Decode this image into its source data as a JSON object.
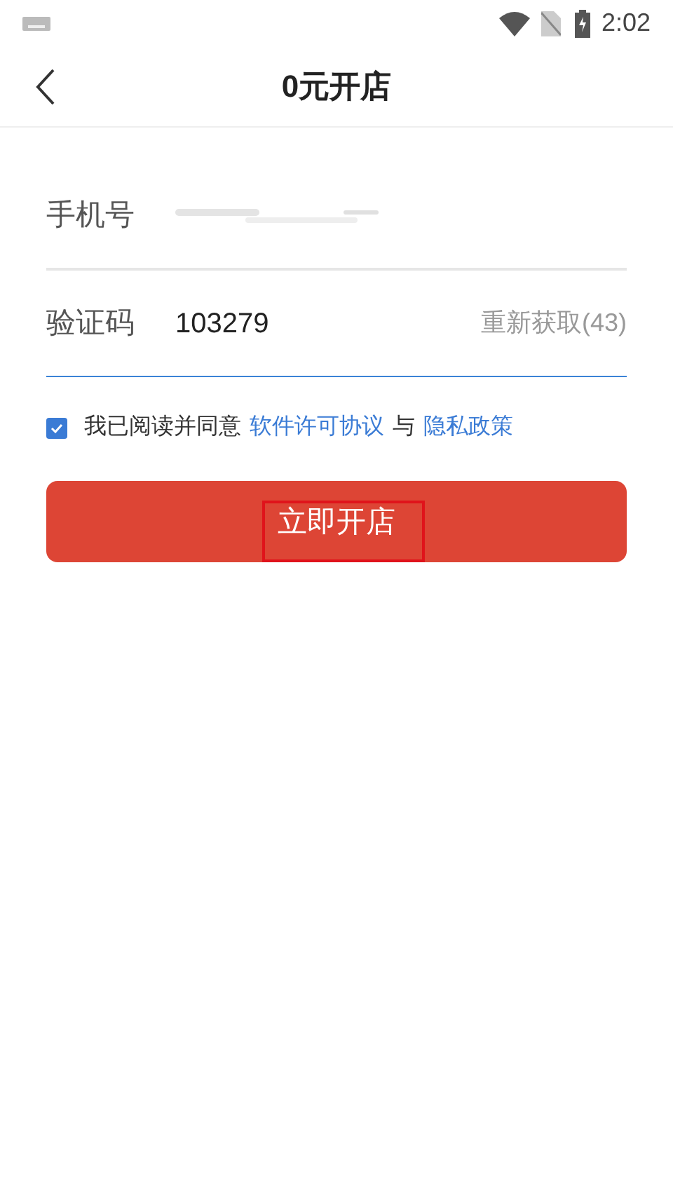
{
  "status_bar": {
    "time": "2:02"
  },
  "header": {
    "title": "0元开店"
  },
  "fields": [
    {
      "label": "手机号",
      "value_hidden": true,
      "focused": false
    },
    {
      "label": "验证码",
      "value": "103279",
      "action": "重新获取(43)",
      "focused": true
    }
  ],
  "agreement": {
    "checked": true,
    "text": "我已阅读并同意",
    "link_1": "软件许可协议",
    "joiner": "与",
    "link_2": "隐私政策"
  },
  "submit_button": {
    "label": "立即开店",
    "highlighted": true
  }
}
